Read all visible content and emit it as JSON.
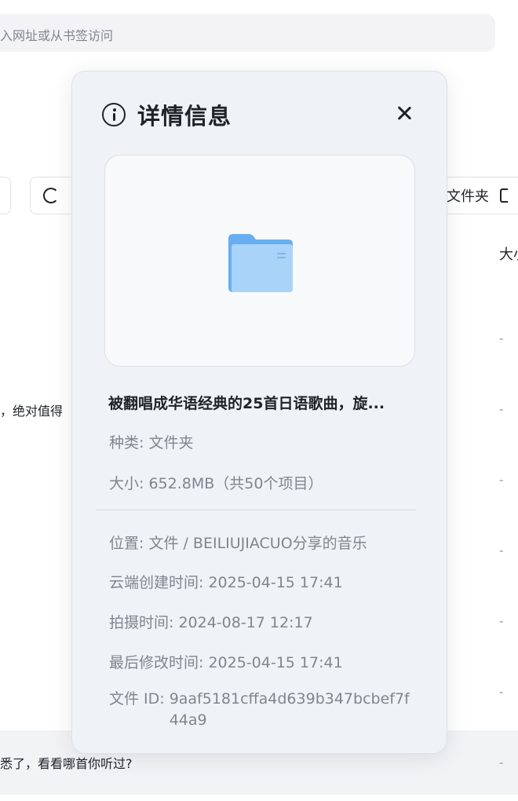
{
  "background": {
    "address_bar_placeholder": "入网址或从书签访问",
    "toolbar": {
      "refresh_label": "",
      "folder_label": "文件夹"
    },
    "column_size_label": "大小",
    "rows": [
      {
        "name_fragment": "",
        "size": "-"
      },
      {
        "name_fragment": "，绝对值得",
        "size": "-"
      },
      {
        "name_fragment": "",
        "size": "-"
      },
      {
        "name_fragment": "",
        "size": "-"
      },
      {
        "name_fragment": "",
        "size": "-"
      },
      {
        "name_fragment": "",
        "size": "-"
      },
      {
        "name_fragment": "悉了，看看哪首你听过?",
        "size": "-"
      }
    ]
  },
  "modal": {
    "title": "详情信息",
    "icon": "info-icon",
    "file_name": "被翻唱成华语经典的25首日语歌曲，旋...",
    "preview_icon": "folder-icon",
    "fields": {
      "type_label": "种类:",
      "type_value": "文件夹",
      "size_label": "大小:",
      "size_value": "652.8MB（共50个项目）",
      "location_label": "位置:",
      "location_value": "文件 / BEILIUJIACUO分享的音乐",
      "cloud_created_label": "云端创建时间:",
      "cloud_created_value": "2025-04-15 17:41",
      "shot_time_label": "拍摄时间:",
      "shot_time_value": "2024-08-17 12:17",
      "modified_label": "最后修改时间:",
      "modified_value": "2025-04-15 17:41",
      "file_id_label": "文件 ID:",
      "file_id_value": "9aaf5181cffa4d639b347bcbef7f44a9"
    }
  },
  "colors": {
    "modal_bg": "#eff2f6",
    "folder_light": "#a9d3f9",
    "folder_dark": "#67aff0",
    "muted_text": "#80858e"
  }
}
